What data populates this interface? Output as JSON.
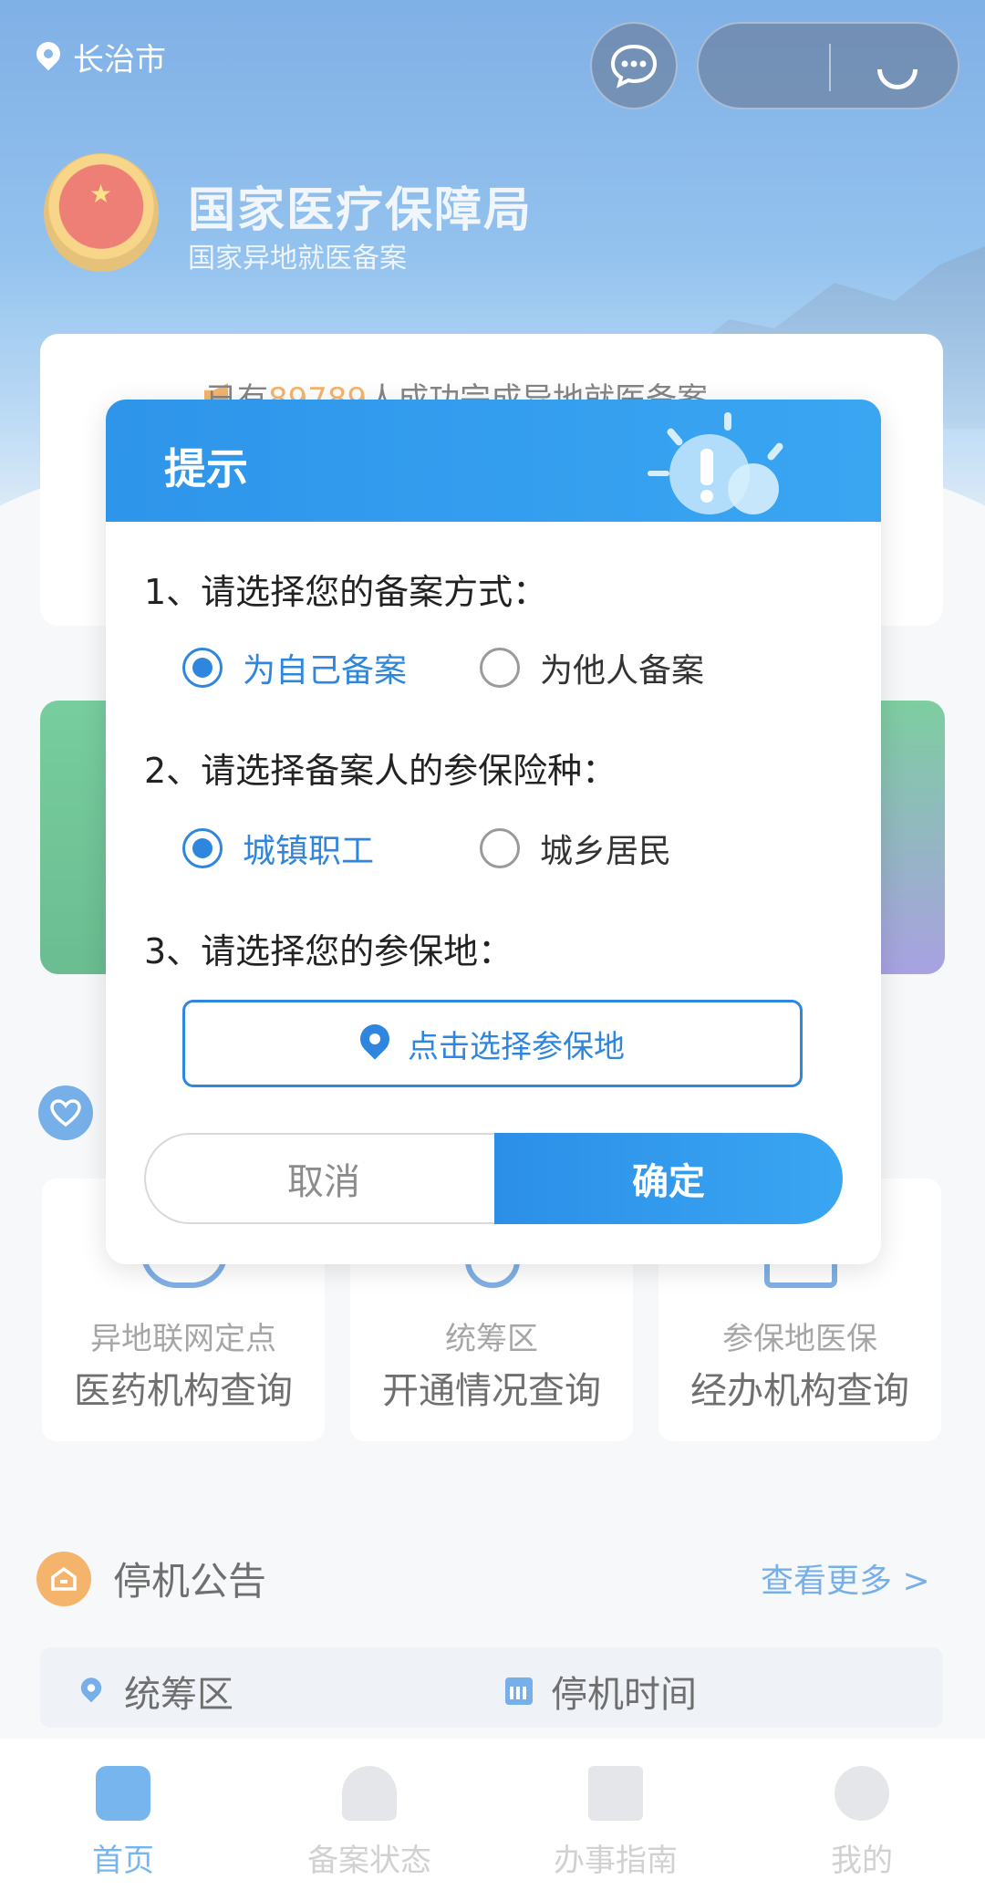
{
  "location": {
    "city": "长治市"
  },
  "header": {
    "org_name": "国家医疗保障局",
    "org_subtitle": "国家异地就医备案"
  },
  "notice": {
    "prefix": "已有",
    "count": "89789",
    "suffix": "人成功完成异地就医备案"
  },
  "services": [
    {
      "line1": "异地联网定点",
      "line2": "医药机构查询"
    },
    {
      "line1": "统筹区",
      "line2": "开通情况查询"
    },
    {
      "line1": "参保地医保",
      "line2": "经办机构查询"
    }
  ],
  "outage": {
    "title": "停机公告",
    "more": "查看更多 >",
    "col_region": "统筹区",
    "col_time": "停机时间"
  },
  "tabs": [
    {
      "label": "首页",
      "active": true
    },
    {
      "label": "备案状态",
      "active": false
    },
    {
      "label": "办事指南",
      "active": false
    },
    {
      "label": "我的",
      "active": false
    }
  ],
  "dialog": {
    "title": "提示",
    "q1": "1、请选择您的备案方式：",
    "q1_options": [
      {
        "label": "为自己备案",
        "selected": true
      },
      {
        "label": "为他人备案",
        "selected": false
      }
    ],
    "q2": "2、请选择备案人的参保险种：",
    "q2_options": [
      {
        "label": "城镇职工",
        "selected": true
      },
      {
        "label": "城乡居民",
        "selected": false
      }
    ],
    "q3": "3、请选择您的参保地：",
    "location_button": "点击选择参保地",
    "cancel": "取消",
    "confirm": "确定"
  },
  "colors": {
    "accent": "#2f86de",
    "orange": "#f08c1e"
  }
}
